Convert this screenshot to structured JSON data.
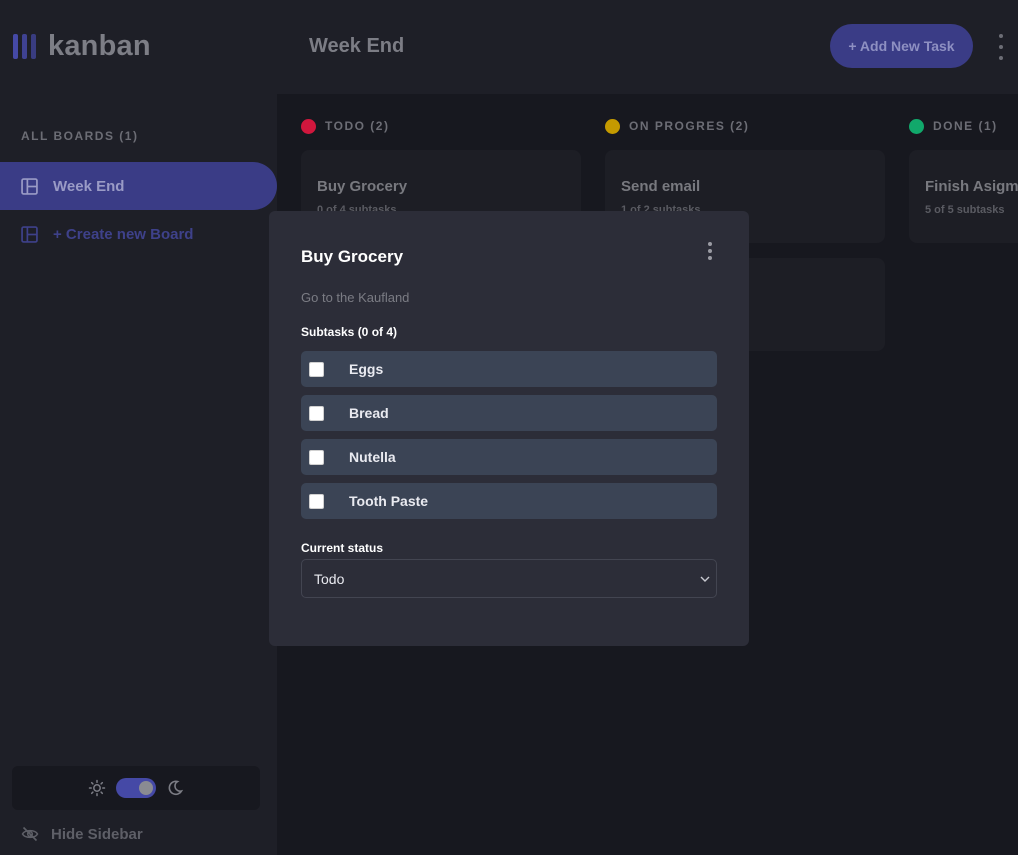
{
  "app": {
    "logo_text": "kanban"
  },
  "header": {
    "board_title": "Week End",
    "add_task_label": "+ Add New Task"
  },
  "sidebar": {
    "heading": "ALL BOARDS (1)",
    "boards": [
      {
        "label": "Week End",
        "active": true
      }
    ],
    "create_label": "+ Create new Board",
    "hide_label": "Hide Sidebar",
    "theme": {
      "mode": "dark",
      "toggle_on": true
    }
  },
  "columns": [
    {
      "title": "TODO (2)",
      "color": "#d1173d",
      "cards": [
        {
          "title": "Buy Grocery",
          "subtasks": "0 of 4 subtasks"
        }
      ]
    },
    {
      "title": "ON PROGRES (2)",
      "color": "#c49a00",
      "cards": [
        {
          "title": "Send email",
          "subtasks": "1 of 2 subtasks"
        }
      ]
    },
    {
      "title": "DONE (1)",
      "color": "#11a86b",
      "cards": [
        {
          "title": "Finish Asigment",
          "subtasks": "5 of 5 subtasks"
        }
      ]
    }
  ],
  "modal": {
    "title": "Buy Grocery",
    "description": "Go to the Kaufland",
    "subtasks_label": "Subtasks (0 of 4)",
    "subtasks": [
      {
        "label": "Eggs",
        "checked": false
      },
      {
        "label": "Bread",
        "checked": false
      },
      {
        "label": "Nutella",
        "checked": false
      },
      {
        "label": "Tooth Paste",
        "checked": false
      }
    ],
    "status_label": "Current status",
    "status_value": "Todo"
  },
  "colors": {
    "accent": "#4549a6",
    "modal_bg": "#2c2d38",
    "subtask_bg": "#3b4455"
  }
}
